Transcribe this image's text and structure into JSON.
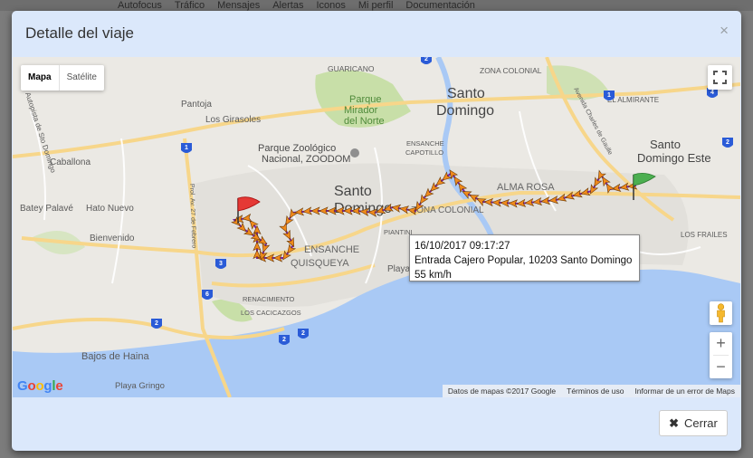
{
  "background_nav": [
    "Autofocus",
    "Tráfico",
    "Mensajes",
    "Alertas",
    "Iconos",
    "Mi perfil",
    "Documentación"
  ],
  "modal": {
    "title": "Detalle del viaje",
    "close_glyph": "×",
    "close_button": "Cerrar"
  },
  "map": {
    "type_options": [
      "Mapa",
      "Satélite"
    ],
    "labels": [
      "GUARICANO",
      "Parque",
      "Mirador",
      "del Norte",
      "Santo",
      "Domingo",
      "EL ALMIRANTE",
      "Pantoja",
      "Los Girasoles",
      "Parque Zoológico",
      "Nacional, ZOODOM",
      "ENSANCHE",
      "CAPOTILLO",
      "Caballona",
      "ALMA ROSA",
      "Santo",
      "Domingo Este",
      "Batey Palavé",
      "Hato Nuevo",
      "Santo",
      "Domingo",
      "ZONA COLONIAL",
      "LOS FRAILES",
      "Bienvenido",
      "ENSANCHE",
      "QUISQUEYA",
      "Playa",
      "RENACIMIENTO",
      "LOS CACICAZGOS",
      "Bajos de Haina",
      "Playa Gringo",
      "ZONA COLONIAL",
      "PIANTINI",
      "Avenida Charles de Gaulle",
      "Autopista de Sto Domingo",
      "Prol. Av. 27 de Febrero"
    ],
    "highway_shields": [
      "1",
      "2",
      "3",
      "4",
      "6",
      "2",
      "2",
      "2",
      "1",
      "2"
    ],
    "tooltip": {
      "datetime": "16/10/2017 09:17:27",
      "location": "Entrada Cajero Popular, 10203 Santo Domingo",
      "speed": "55 km/h"
    },
    "attribution": [
      "Datos de mapas ©2017 Google",
      "Términos de uso",
      "Informar de un error de Maps"
    ],
    "logo": "Google",
    "zoom_in": "+",
    "zoom_out": "−"
  },
  "colors": {
    "route": "#7b1fa2",
    "arrow": "#f08a1c",
    "start_flag": "#4caf50",
    "end_flag": "#e53935",
    "water": "#a9c9f5"
  }
}
